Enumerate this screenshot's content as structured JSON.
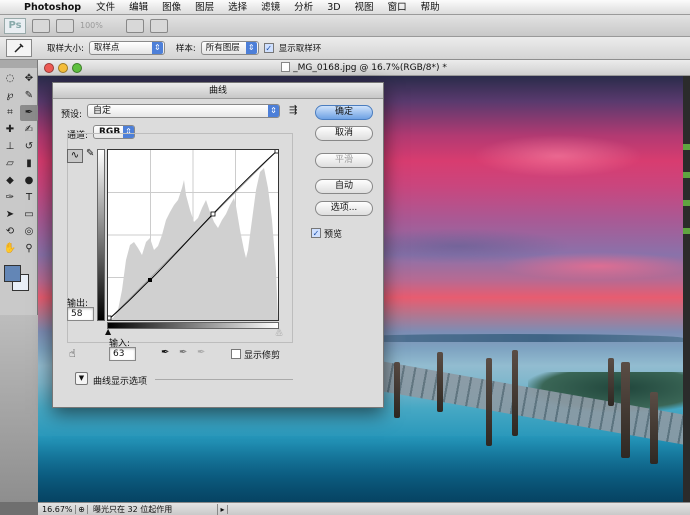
{
  "menubar": {
    "app": "Photoshop",
    "items": [
      "文件",
      "编辑",
      "图像",
      "图层",
      "选择",
      "滤镜",
      "分析",
      "3D",
      "视图",
      "窗口",
      "帮助"
    ]
  },
  "appbar": {
    "logo": "Ps",
    "zoom": "100%"
  },
  "options": {
    "sample_size_label": "取样大小:",
    "sample_size_value": "取样点",
    "sample_label": "样本:",
    "sample_value": "所有图层",
    "show_ring_label": "显示取样环"
  },
  "document": {
    "title": "_MG_0168.jpg @ 16.7%(RGB/8*) *"
  },
  "status": {
    "zoom": "16.67%",
    "message": "曝光只在 32 位起作用"
  },
  "curves": {
    "title": "曲线",
    "preset_label": "预设:",
    "preset_value": "自定",
    "channel_label": "通道:",
    "channel_value": "RGB",
    "output_label": "输出:",
    "output_value": "58",
    "input_label": "输入:",
    "input_value": "63",
    "show_clipping_label": "显示修剪",
    "display_options_label": "曲线显示选项",
    "buttons": {
      "ok": "确定",
      "cancel": "取消",
      "smooth": "平滑",
      "auto": "自动",
      "options": "选项..."
    },
    "preview_label": "预览",
    "preview_checked": true
  },
  "colors": {
    "accent": "#4d7fd8",
    "foreground_swatch": "#6386b6",
    "background_swatch": "#e9eff7"
  }
}
